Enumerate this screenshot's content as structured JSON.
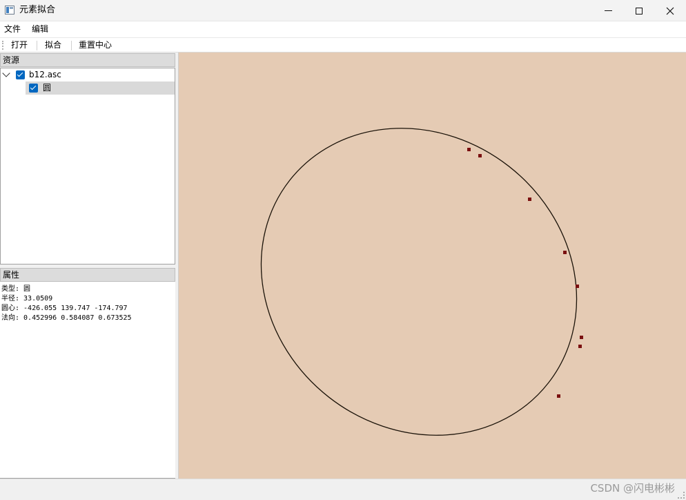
{
  "window": {
    "title": "元素拟合",
    "icon": "app-window-icon"
  },
  "menu": {
    "items": [
      "文件",
      "编辑"
    ]
  },
  "toolbar": {
    "open_label": "打开",
    "fit_label": "拟合",
    "reset_label": "重置中心"
  },
  "resources": {
    "header": "资源",
    "tree": [
      {
        "label": "b12.asc",
        "checked": true,
        "expanded": true,
        "children": [
          {
            "label": "圆",
            "checked": true,
            "selected": true
          }
        ]
      }
    ]
  },
  "properties": {
    "header": "属性",
    "lines": [
      "类型: 圆",
      "半径: 33.0509",
      "圆心: -426.055 139.747 -174.797",
      "法向: 0.452996 0.584087 0.673525"
    ]
  },
  "viewport": {
    "background": "#e5cbb4",
    "curve_color": "#1a1208",
    "point_color": "#7a1010",
    "point_count": 8
  },
  "status": {
    "watermark": "CSDN @闪电彬彬"
  }
}
